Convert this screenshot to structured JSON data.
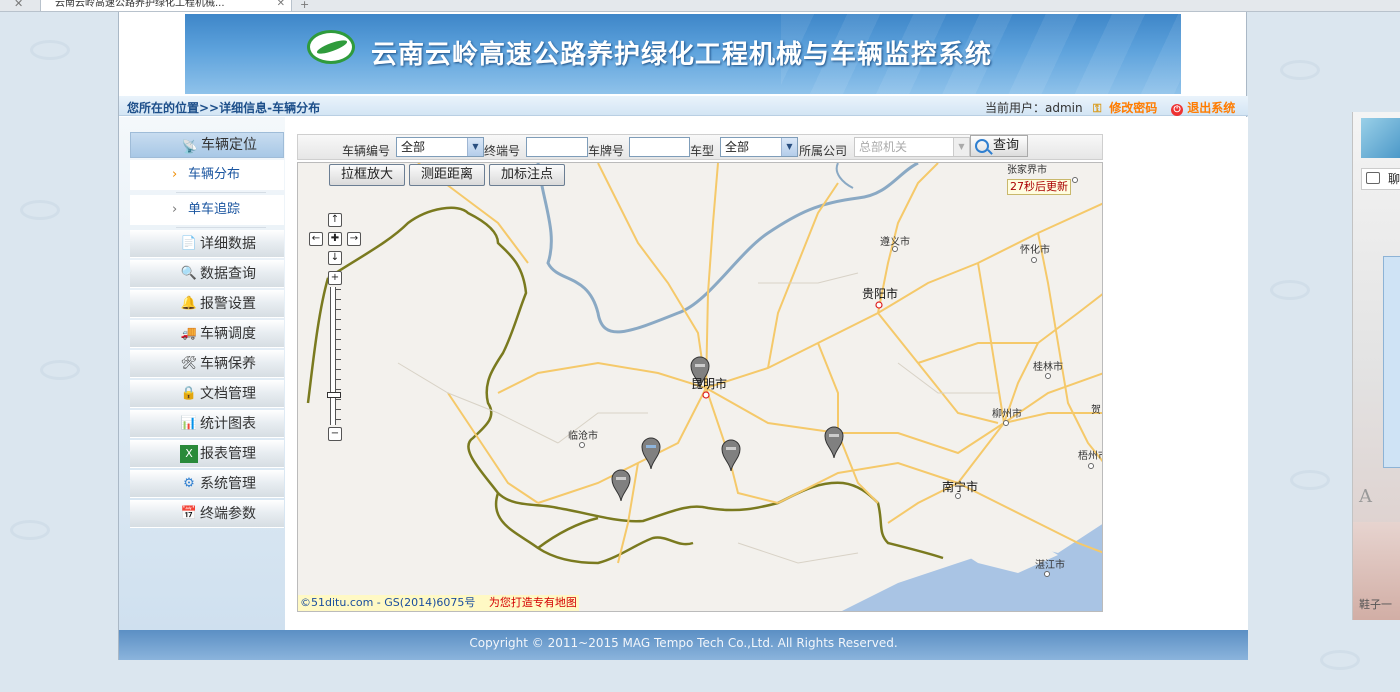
{
  "browser": {
    "tab_title": "云南云岭高速公路养护绿化工程机械..."
  },
  "header": {
    "banner_title": "云南云岭高速公路养护绿化工程机械与车辆监控系统",
    "location": "您所在的位置>>详细信息-车辆分布",
    "current_user": "当前用户：admin",
    "change_password": "修改密码",
    "logout": "退出系统"
  },
  "sidebar": {
    "group_label": "车辆定位",
    "sub_items": [
      {
        "label": "车辆分布",
        "active": true
      },
      {
        "label": "单车追踪",
        "active": false
      }
    ],
    "items": [
      {
        "label": "详细数据",
        "icon": "document-icon"
      },
      {
        "label": "数据查询",
        "icon": "search-icon"
      },
      {
        "label": "报警设置",
        "icon": "bell-icon"
      },
      {
        "label": "车辆调度",
        "icon": "truck-icon"
      },
      {
        "label": "车辆保养",
        "icon": "tools-icon"
      },
      {
        "label": "文档管理",
        "icon": "locked-file-icon"
      },
      {
        "label": "统计图表",
        "icon": "bar-chart-icon"
      },
      {
        "label": "报表管理",
        "icon": "excel-icon"
      },
      {
        "label": "系统管理",
        "icon": "gear-icon"
      },
      {
        "label": "终端参数",
        "icon": "calendar-icon"
      }
    ]
  },
  "filter": {
    "vehicle_no_label": "车辆编号",
    "vehicle_no_value": "全部",
    "terminal_no_label": "终端号",
    "terminal_no_value": "",
    "plate_label": "车牌号",
    "plate_value": "",
    "type_label": "车型",
    "type_value": "全部",
    "company_label": "所属公司",
    "company_value": "总部机关",
    "query_button": "查询"
  },
  "map": {
    "tools": [
      "拉框放大",
      "测距距离",
      "加标注点"
    ],
    "refresh_countdown": "27秒后更新",
    "cities": [
      {
        "name": "张家界市",
        "big": false
      },
      {
        "name": "遵义市",
        "big": false
      },
      {
        "name": "怀化市",
        "big": false
      },
      {
        "name": "贵阳市",
        "big": true
      },
      {
        "name": "昆明市",
        "big": true
      },
      {
        "name": "桂林市",
        "big": false
      },
      {
        "name": "临沧市",
        "big": false
      },
      {
        "name": "柳州市",
        "big": false
      },
      {
        "name": "贺",
        "big": false
      },
      {
        "name": "梧州市",
        "big": false
      },
      {
        "name": "南宁市",
        "big": true
      },
      {
        "name": "湛江市",
        "big": false
      }
    ],
    "copyright": "©51ditu.com - GS(2014)6075号",
    "slogan": "为您打造专有地图",
    "vehicle_markers": 5,
    "zoom_level_fraction": 0.2
  },
  "footer": {
    "copyright": "Copyright © 2011~2015 MAG Tempo Tech Co.,Ltd. All Rights Reserved."
  },
  "side_window": {
    "chat_label": "聊",
    "font_glyph": "A",
    "caption": "鞋子一"
  },
  "colors": {
    "link_blue": "#1a55a0",
    "accent_orange": "#ff7c00",
    "banner_blue": "#3e86c8",
    "border_green": "#7a7a1f",
    "road_yellow": "#f5c96a",
    "river_blue": "#8aa9c4"
  }
}
